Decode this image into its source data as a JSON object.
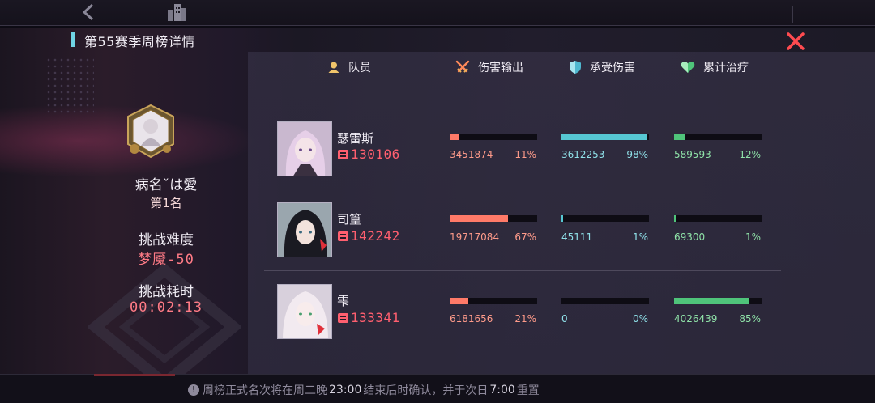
{
  "title": "第55赛季周榜详情",
  "player": {
    "name": "病名ˇは愛",
    "rank": "第1名",
    "difficulty_label": "挑战难度",
    "difficulty_value": "梦魇-50",
    "time_label": "挑战耗时",
    "time_value": "00:02:13"
  },
  "columns": {
    "member": "队员",
    "damage": "伤害输出",
    "taken": "承受伤害",
    "healing": "累计治疗"
  },
  "colors": {
    "damage": "#ff7a68",
    "taken": "#56c7d3",
    "healing": "#4fc47a",
    "accent": "#ff5f6f"
  },
  "members": [
    {
      "name": "瑟雷斯",
      "power": "130106",
      "damage": {
        "value": "3451874",
        "pct": "11%",
        "ratio": 0.11
      },
      "taken": {
        "value": "3612253",
        "pct": "98%",
        "ratio": 0.98
      },
      "healing": {
        "value": "589593",
        "pct": "12%",
        "ratio": 0.12
      }
    },
    {
      "name": "司篁",
      "power": "142242",
      "damage": {
        "value": "19717084",
        "pct": "67%",
        "ratio": 0.67
      },
      "taken": {
        "value": "45111",
        "pct": "1%",
        "ratio": 0.01
      },
      "healing": {
        "value": "69300",
        "pct": "1%",
        "ratio": 0.01
      }
    },
    {
      "name": "雫",
      "power": "133341",
      "damage": {
        "value": "6181656",
        "pct": "21%",
        "ratio": 0.21
      },
      "taken": {
        "value": "0",
        "pct": "0%",
        "ratio": 0
      },
      "healing": {
        "value": "4026439",
        "pct": "85%",
        "ratio": 0.85
      }
    }
  ],
  "footer": {
    "t1": "周榜正式名次将在周二晚",
    "time1": "23:00",
    "t2": "结束后时确认，并于次日",
    "time2": "7:00",
    "t3": "重置"
  }
}
